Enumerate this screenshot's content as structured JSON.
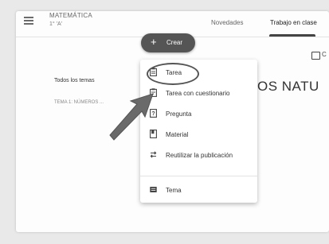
{
  "header": {
    "class_name": "MATEMÁTICA",
    "section": "1° 'A'",
    "tabs": [
      {
        "label": "Novedades",
        "active": false
      },
      {
        "label": "Trabajo en clase",
        "active": true
      }
    ]
  },
  "toolbar": {
    "create_label": "Crear",
    "calendar_label": "C"
  },
  "sidebar": {
    "all_topics": "Todos los temas",
    "topics": [
      "TEMA 1: NÚMEROS ..."
    ]
  },
  "main": {
    "heading_fragment": "OS NATU"
  },
  "create_menu": {
    "items": [
      {
        "label": "Tarea",
        "icon": "assignment-icon",
        "highlighted": true
      },
      {
        "label": "Tarea con cuestionario",
        "icon": "quiz-assignment-icon"
      },
      {
        "label": "Pregunta",
        "icon": "question-icon"
      },
      {
        "label": "Material",
        "icon": "material-icon"
      },
      {
        "label": "Reutilizar la publicación",
        "icon": "reuse-post-icon"
      },
      {
        "label": "Tema",
        "icon": "topic-icon"
      }
    ]
  },
  "colors": {
    "create_button": "#555555",
    "arrow": "#6a6a6a",
    "highlight_ring": "#555555"
  }
}
